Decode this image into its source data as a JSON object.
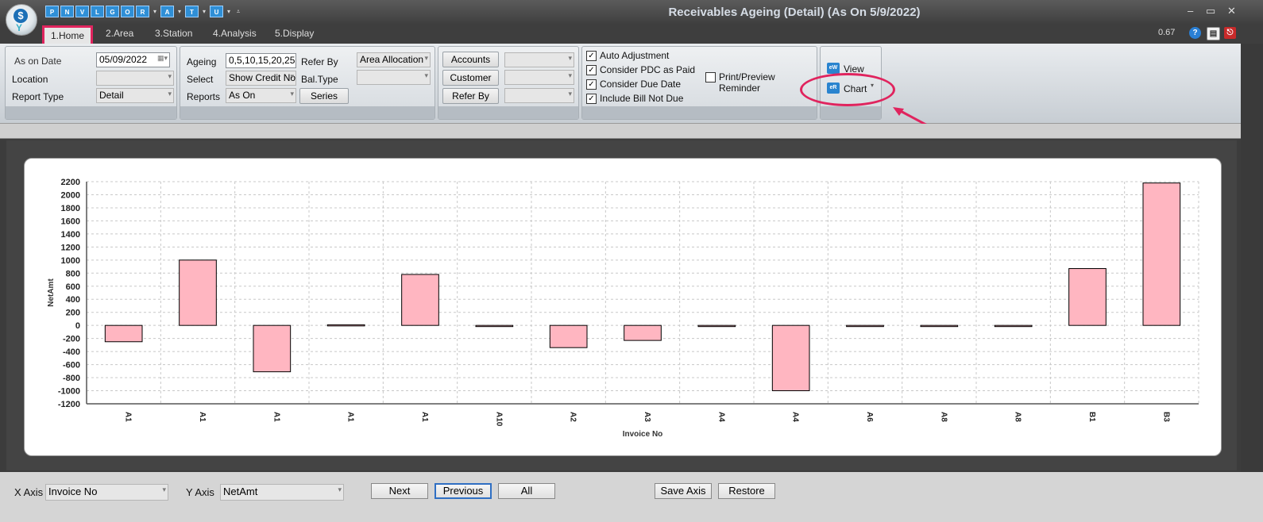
{
  "window": {
    "title": "Receivables Ageing (Detail) (As On 5/9/2022)",
    "controls": [
      "–",
      "▭",
      "✕"
    ]
  },
  "quick_access": [
    {
      "label": "P"
    },
    {
      "label": "N"
    },
    {
      "label": "V"
    },
    {
      "label": "L"
    },
    {
      "label": "G"
    },
    {
      "label": "O"
    },
    {
      "label": "R",
      "arrow": true
    },
    {
      "label": "A",
      "arrow": true
    },
    {
      "label": "T",
      "arrow": true
    },
    {
      "label": "U",
      "arrow": true
    }
  ],
  "menu": {
    "tabs": [
      "1.Home",
      "2.Area",
      "3.Station",
      "4.Analysis",
      "5.Display"
    ],
    "active": "1.Home",
    "zoom": "0.67",
    "help_icon": "?"
  },
  "ribbon": {
    "group1": {
      "as_on_date_label": "As on Date",
      "as_on_date_value": "05/09/2022",
      "location_label": "Location",
      "location_value": "",
      "report_type_label": "Report Type",
      "report_type_value": "Detail"
    },
    "group2": {
      "ageing_label": "Ageing",
      "ageing_value": "0,5,10,15,20,25",
      "select_label": "Select",
      "select_value": "Show Credit No",
      "reports_label": "Reports",
      "reports_value": "As On",
      "refer_by_label": "Refer By",
      "refer_by_value": "Area Allocation",
      "bal_type_label": "Bal.Type",
      "bal_type_value": "",
      "series_button": "Series"
    },
    "group3": {
      "accounts_button": "Accounts",
      "customer_button": "Customer",
      "refer_by_button": "Refer By"
    },
    "group4": {
      "auto_adjustment": "Auto Adjustment",
      "consider_pdc": "Consider PDC as Paid",
      "consider_due_date": "Consider Due Date",
      "include_bill_not_due": "Include Bill Not Due",
      "print_preview_reminder": "Print/Preview Reminder",
      "checked": {
        "auto_adjustment": true,
        "consider_pdc": true,
        "consider_due_date": true,
        "include_bill_not_due": true,
        "print_preview_reminder": false
      }
    },
    "group5": {
      "view_button": "View",
      "chart_button": "Chart"
    }
  },
  "chart_data": {
    "type": "bar",
    "title": "",
    "xlabel": "Invoice No",
    "ylabel": "NetAmt",
    "categories": [
      "A1",
      "A1",
      "A1",
      "A1",
      "A1",
      "A10",
      "A2",
      "A3",
      "A4",
      "A4",
      "A6",
      "A8",
      "A8",
      "B1",
      "B3"
    ],
    "values": [
      -250,
      1000,
      -710,
      10,
      780,
      -10,
      -340,
      -230,
      -10,
      -1000,
      -10,
      -10,
      -10,
      870,
      2180
    ],
    "ylim": [
      -1200,
      2200
    ],
    "yticks": [
      "2200",
      "2000",
      "1800",
      "1600",
      "1400",
      "1200",
      "1000",
      "800",
      "600",
      "400",
      "200",
      "0",
      "-200",
      "-400",
      "-600",
      "-800",
      "-1000",
      "-1200"
    ],
    "grid": true,
    "bar_color": "#ffb6c1"
  },
  "bottom": {
    "x_axis_label": "X Axis",
    "x_axis_value": "Invoice No",
    "y_axis_label": "Y Axis",
    "y_axis_value": "NetAmt",
    "next_button": "Next",
    "previous_button": "Previous",
    "all_button": "All",
    "save_axis_button": "Save Axis",
    "restore_button": "Restore"
  }
}
